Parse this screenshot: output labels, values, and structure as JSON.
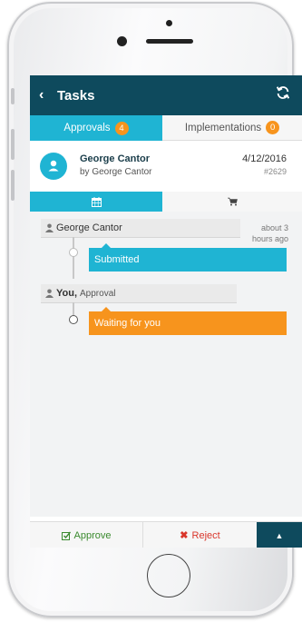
{
  "header": {
    "back_icon": "chevron-left-icon",
    "title": "Tasks",
    "refresh_icon": "refresh-icon"
  },
  "tabs": [
    {
      "label": "Approvals",
      "badge": "4",
      "active": true
    },
    {
      "label": "Implementations",
      "badge": "0",
      "active": false
    }
  ],
  "task": {
    "name": "George Cantor",
    "by": "by George Cantor",
    "date": "4/12/2016",
    "number": "#2629",
    "avatar_icon": "user-icon"
  },
  "subtabs": [
    {
      "icon": "calendar-icon",
      "active": true
    },
    {
      "icon": "cart-icon",
      "active": false
    }
  ],
  "timeline": [
    {
      "person": "George Cantor",
      "role": "",
      "time_ago_line1": "about 3",
      "time_ago_line2": "hours ago",
      "status": "Submitted",
      "status_color": "#1fb4d3"
    },
    {
      "person": "You,",
      "role": "Approval",
      "status": "Waiting for you",
      "status_color": "#f7941d"
    }
  ],
  "actions": {
    "approve_label": "Approve",
    "reject_label": "Reject",
    "approve_icon": "check-square-icon",
    "reject_icon": "x-icon",
    "expand_icon": "caret-up-icon"
  },
  "colors": {
    "header": "#0e4a5d",
    "accent": "#1fb4d3",
    "badge": "#f7941d",
    "approve": "#3a8a2e",
    "reject": "#d9362b"
  }
}
